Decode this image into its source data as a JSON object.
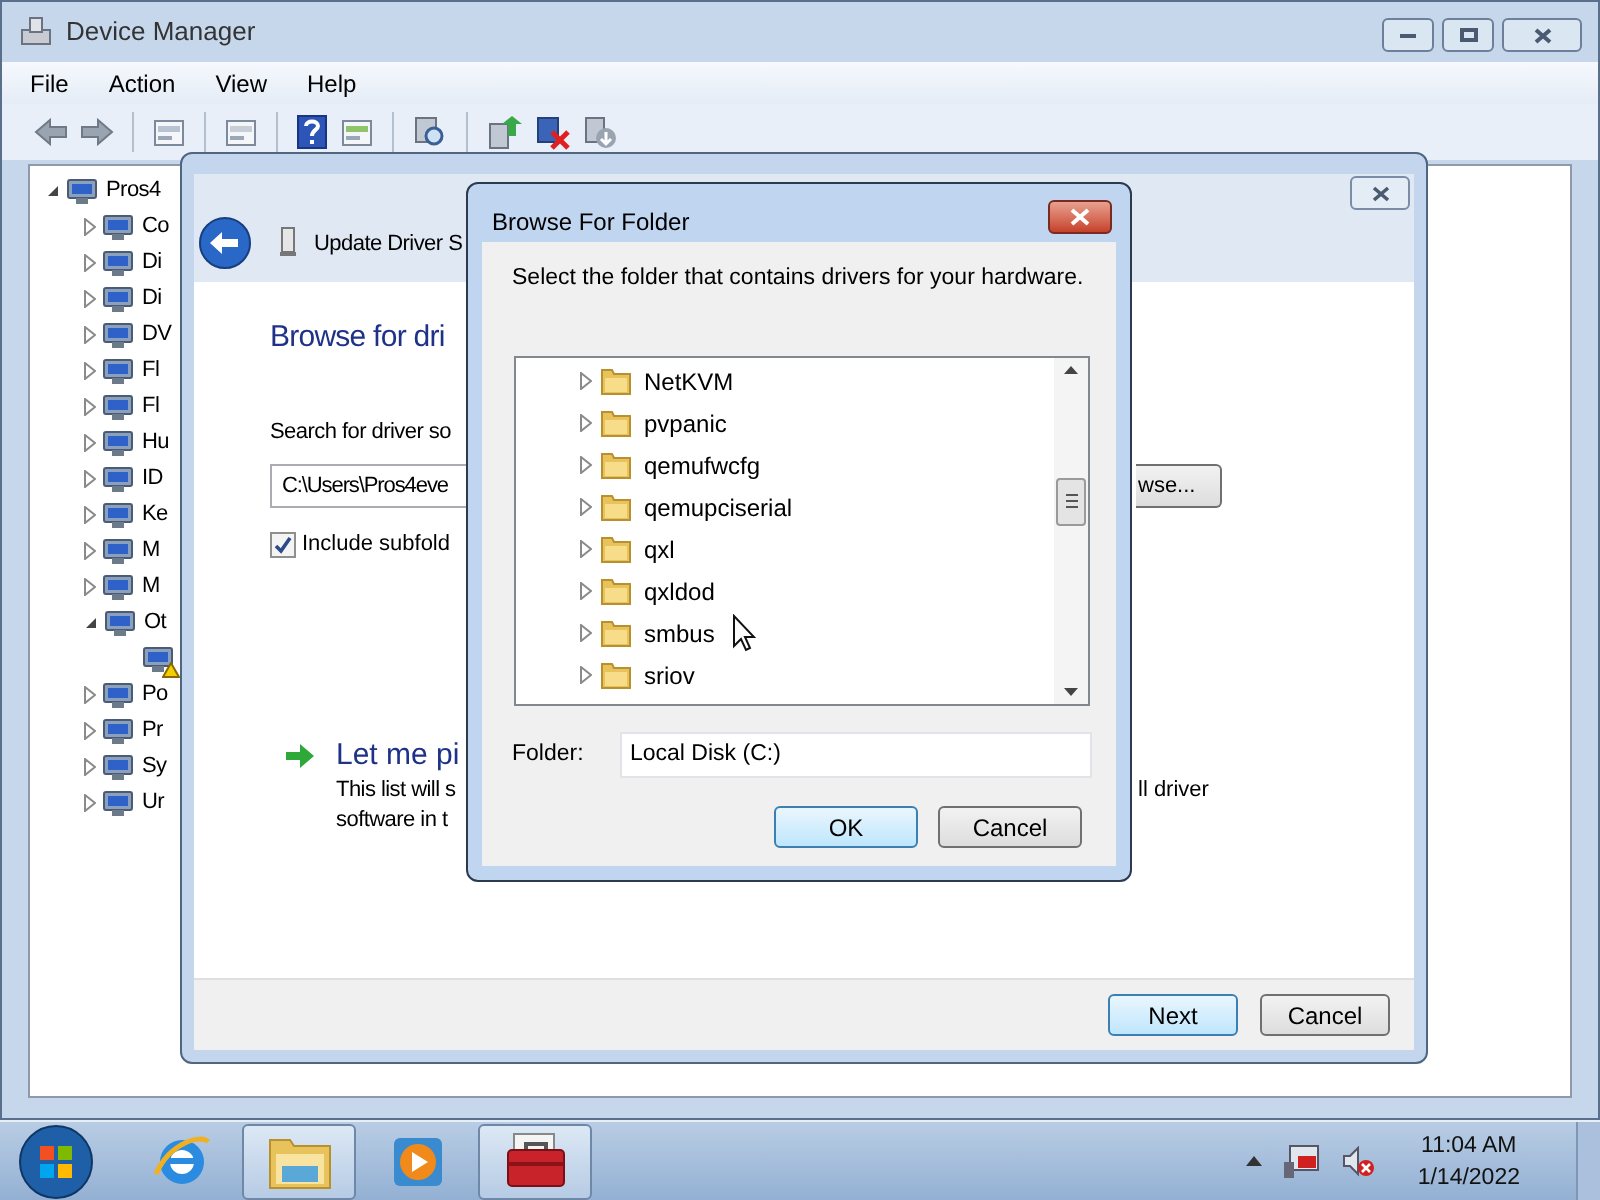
{
  "device_manager": {
    "title": "Device Manager",
    "menu": [
      "File",
      "Action",
      "View",
      "Help"
    ],
    "tree": [
      {
        "label": "Pros4",
        "expanded": true,
        "children": [
          {
            "label": "Co",
            "expanded": false
          },
          {
            "label": "Di",
            "expanded": false
          },
          {
            "label": "Di",
            "expanded": false
          },
          {
            "label": "DV",
            "expanded": false
          },
          {
            "label": "Fl",
            "expanded": false
          },
          {
            "label": "Fl",
            "expanded": false
          },
          {
            "label": "Hu",
            "expanded": false
          },
          {
            "label": "ID",
            "expanded": false
          },
          {
            "label": "Ke",
            "expanded": false
          },
          {
            "label": "M",
            "expanded": false
          },
          {
            "label": "M",
            "expanded": false
          },
          {
            "label": "Ot",
            "expanded": true,
            "children": [
              {
                "warning": true
              }
            ]
          },
          {
            "label": "Po",
            "expanded": false
          },
          {
            "label": "Pr",
            "expanded": false
          },
          {
            "label": "Sy",
            "expanded": false
          },
          {
            "label": "Ur",
            "expanded": false
          }
        ]
      }
    ]
  },
  "update_driver": {
    "title": "Update Driver S",
    "heading": "Browse for dri",
    "search_label": "Search for driver so",
    "path": "C:\\Users\\Pros4eve",
    "browse_button": "wse...",
    "include_subfolders": {
      "label": "Include subfold",
      "checked": true
    },
    "pick_title": "Let me pi",
    "pick_lines": [
      "This list will s",
      "software in t"
    ],
    "pick_right": "ll driver",
    "buttons": [
      {
        "label": "Next",
        "default": true
      },
      {
        "label": "Cancel",
        "default": false
      }
    ]
  },
  "browse_dialog": {
    "title": "Browse For Folder",
    "instruction": "Select the folder that contains drivers for your hardware.",
    "folders": [
      {
        "label": "NetKVM",
        "expanded": false
      },
      {
        "label": "pvpanic",
        "expanded": false
      },
      {
        "label": "qemufwcfg",
        "expanded": false
      },
      {
        "label": "qemupciserial",
        "expanded": false
      },
      {
        "label": "qxl",
        "expanded": false
      },
      {
        "label": "qxldod",
        "expanded": false
      },
      {
        "label": "smbus",
        "expanded": false
      },
      {
        "label": "sriov",
        "expanded": false
      }
    ],
    "folder_label": "Folder:",
    "folder_value": "Local Disk (C:)",
    "buttons": [
      {
        "label": "OK",
        "default": true
      },
      {
        "label": "Cancel",
        "default": false
      }
    ]
  },
  "taskbar": {
    "items": [
      {
        "kind": "browser",
        "open": false
      },
      {
        "kind": "folders",
        "open": true
      },
      {
        "kind": "media",
        "open": false
      },
      {
        "kind": "toolbox",
        "open": true
      }
    ],
    "time": "11:04 AM",
    "date": "1/14/2022"
  }
}
